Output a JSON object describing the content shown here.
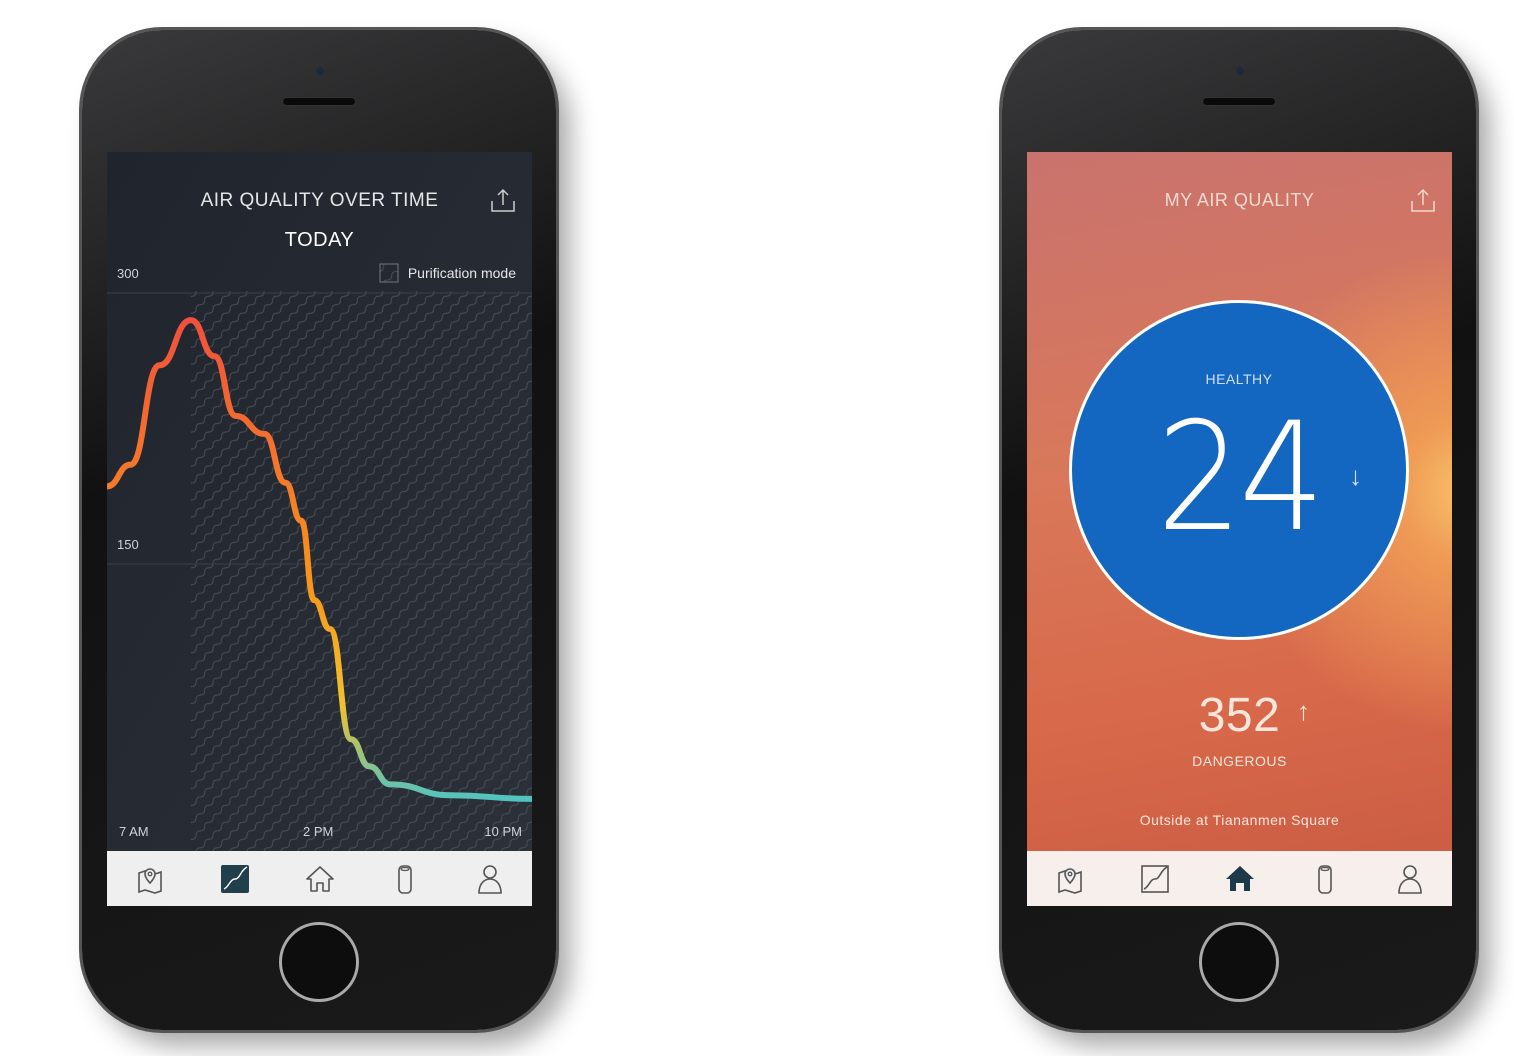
{
  "left_screen": {
    "title": "AIR QUALITY OVER TIME",
    "period": "TODAY",
    "legend_label": "Purification mode",
    "icons": {
      "share": "share-icon",
      "legend": "hatch-pattern-icon"
    },
    "nav": [
      {
        "icon": "map-pin-icon",
        "active": false
      },
      {
        "icon": "chart-icon",
        "active": true
      },
      {
        "icon": "home-icon",
        "active": false
      },
      {
        "icon": "purifier-icon",
        "active": false
      },
      {
        "icon": "user-icon",
        "active": false
      }
    ]
  },
  "chart_data": {
    "type": "line",
    "title": "AIR QUALITY OVER TIME",
    "subtitle": "TODAY",
    "y_ticks": [
      "300",
      "150"
    ],
    "x_ticks": [
      "7 AM",
      "2 PM",
      "10 PM"
    ],
    "ylim": [
      0,
      330
    ],
    "xlim_hours": [
      5.9,
      22.1
    ],
    "shaded_region": {
      "label": "Purification mode",
      "from_hour": 9.1
    },
    "grid": true,
    "x": [
      5.9,
      6.8,
      7.9,
      9.1,
      10.0,
      10.8,
      11.9,
      12.7,
      13.3,
      13.8,
      14.4,
      15.2,
      15.9,
      16.7,
      19.0,
      22.1
    ],
    "values": [
      193,
      205,
      260,
      285,
      265,
      232,
      222,
      195,
      174,
      130,
      114,
      53,
      38,
      28,
      22,
      20
    ],
    "colors": {
      "high": "#f04e3e",
      "mid": "#f7941d",
      "low_mid": "#f2c12e",
      "low": "#4cc3c4"
    }
  },
  "right_screen": {
    "title": "MY AIR QUALITY",
    "indoor_status": "HEALTHY",
    "indoor_value": "24",
    "indoor_trend": "↓",
    "outdoor_value": "352",
    "outdoor_trend": "↑",
    "outdoor_status": "DANGEROUS",
    "location": "Outside at Tiananmen Square",
    "colors": {
      "circle": "#1467c0",
      "background": "#d9694a"
    },
    "nav": [
      {
        "icon": "map-pin-icon",
        "active": false
      },
      {
        "icon": "chart-icon",
        "active": false
      },
      {
        "icon": "home-icon",
        "active": true
      },
      {
        "icon": "purifier-icon",
        "active": false
      },
      {
        "icon": "user-icon",
        "active": false
      }
    ]
  }
}
